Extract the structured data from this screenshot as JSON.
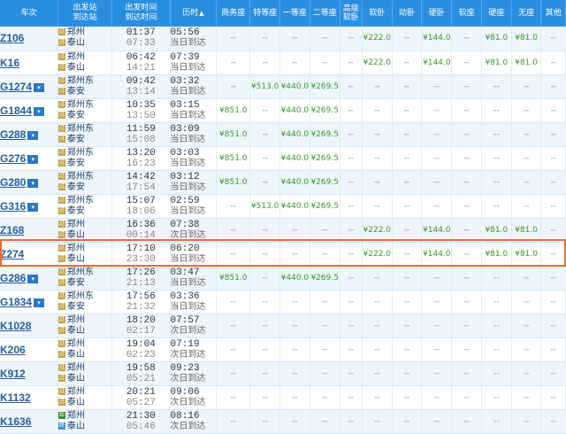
{
  "headers": {
    "train": "车次",
    "stations": [
      "出发站",
      "到达站"
    ],
    "times": [
      "出发时间",
      "到达时间"
    ],
    "duration": "历时",
    "seats": [
      "商务座",
      "特等座",
      "一等座",
      "二等座",
      "高级软卧",
      "软卧",
      "动卧",
      "硬卧",
      "软座",
      "硬座",
      "无座",
      "其他"
    ],
    "sort_arrow": "▲"
  },
  "rows": [
    {
      "train": "Z106",
      "dropdown": false,
      "dep_station": "郑州",
      "arr_station": "泰山",
      "dep_type": "pass",
      "arr_type": "pass",
      "dep_time": "01:37",
      "arr_time": "07:33",
      "duration": "05:56",
      "arrival_note": "当日到达",
      "seats": [
        "--",
        "--",
        "--",
        "--",
        "--",
        "¥222.0",
        "--",
        "¥144.0",
        "--",
        "¥81.0",
        "¥81.0",
        "--"
      ]
    },
    {
      "train": "K16",
      "dropdown": false,
      "dep_station": "郑州",
      "arr_station": "泰山",
      "dep_type": "pass",
      "arr_type": "pass",
      "dep_time": "06:42",
      "arr_time": "14:21",
      "duration": "07:39",
      "arrival_note": "当日到达",
      "seats": [
        "--",
        "--",
        "--",
        "--",
        "--",
        "¥222.0",
        "--",
        "¥144.0",
        "--",
        "¥81.0",
        "¥81.0",
        "--"
      ]
    },
    {
      "train": "G1274",
      "dropdown": true,
      "dep_station": "郑州东",
      "arr_station": "泰安",
      "dep_type": "pass",
      "arr_type": "pass",
      "dep_time": "09:42",
      "arr_time": "13:14",
      "duration": "03:32",
      "arrival_note": "当日到达",
      "seats": [
        "--",
        "¥513.0",
        "¥440.0",
        "¥269.5",
        "--",
        "--",
        "--",
        "--",
        "--",
        "--",
        "--",
        "--"
      ]
    },
    {
      "train": "G1844",
      "dropdown": true,
      "dep_station": "郑州东",
      "arr_station": "泰安",
      "dep_type": "pass",
      "arr_type": "pass",
      "dep_time": "10:35",
      "arr_time": "13:50",
      "duration": "03:15",
      "arrival_note": "当日到达",
      "seats": [
        "¥851.0",
        "--",
        "¥440.0",
        "¥269.5",
        "--",
        "--",
        "--",
        "--",
        "--",
        "--",
        "--",
        "--"
      ]
    },
    {
      "train": "G288",
      "dropdown": true,
      "dep_station": "郑州东",
      "arr_station": "泰安",
      "dep_type": "pass",
      "arr_type": "pass",
      "dep_time": "11:59",
      "arr_time": "15:08",
      "duration": "03:09",
      "arrival_note": "当日到达",
      "seats": [
        "¥851.0",
        "--",
        "¥440.0",
        "¥269.5",
        "--",
        "--",
        "--",
        "--",
        "--",
        "--",
        "--",
        "--"
      ]
    },
    {
      "train": "G276",
      "dropdown": true,
      "dep_station": "郑州东",
      "arr_station": "泰安",
      "dep_type": "pass",
      "arr_type": "pass",
      "dep_time": "13:20",
      "arr_time": "16:23",
      "duration": "03:03",
      "arrival_note": "当日到达",
      "seats": [
        "¥851.0",
        "--",
        "¥440.0",
        "¥269.5",
        "--",
        "--",
        "--",
        "--",
        "--",
        "--",
        "--",
        "--"
      ]
    },
    {
      "train": "G280",
      "dropdown": true,
      "dep_station": "郑州东",
      "arr_station": "泰安",
      "dep_type": "pass",
      "arr_type": "pass",
      "dep_time": "14:42",
      "arr_time": "17:54",
      "duration": "03:12",
      "arrival_note": "当日到达",
      "seats": [
        "¥851.0",
        "--",
        "¥440.0",
        "¥269.5",
        "--",
        "--",
        "--",
        "--",
        "--",
        "--",
        "--",
        "--"
      ]
    },
    {
      "train": "G316",
      "dropdown": true,
      "dep_station": "郑州东",
      "arr_station": "泰安",
      "dep_type": "pass",
      "arr_type": "pass",
      "dep_time": "15:07",
      "arr_time": "18:06",
      "duration": "02:59",
      "arrival_note": "当日到达",
      "seats": [
        "--",
        "¥513.0",
        "¥440.0",
        "¥269.5",
        "--",
        "--",
        "--",
        "--",
        "--",
        "--",
        "--",
        "--"
      ]
    },
    {
      "train": "Z168",
      "dropdown": false,
      "dep_station": "郑州",
      "arr_station": "泰山",
      "dep_type": "pass",
      "arr_type": "pass",
      "dep_time": "16:36",
      "arr_time": "00:14",
      "duration": "07:38",
      "arrival_note": "次日到达",
      "seats": [
        "--",
        "--",
        "--",
        "--",
        "--",
        "¥222.0",
        "--",
        "¥144.0",
        "--",
        "¥81.0",
        "¥81.0",
        "--"
      ]
    },
    {
      "train": "Z274",
      "dropdown": false,
      "dep_station": "郑州",
      "arr_station": "泰山",
      "dep_type": "pass",
      "arr_type": "pass",
      "dep_time": "17:10",
      "arr_time": "23:30",
      "duration": "06:20",
      "arrival_note": "当日到达",
      "seats": [
        "--",
        "--",
        "--",
        "--",
        "--",
        "¥222.0",
        "--",
        "¥144.0",
        "--",
        "¥81.0",
        "¥81.0",
        "--"
      ]
    },
    {
      "train": "G286",
      "dropdown": true,
      "dep_station": "郑州东",
      "arr_station": "泰安",
      "dep_type": "pass",
      "arr_type": "pass",
      "dep_time": "17:26",
      "arr_time": "21:13",
      "duration": "03:47",
      "arrival_note": "当日到达",
      "seats": [
        "¥851.0",
        "--",
        "¥440.0",
        "¥269.5",
        "--",
        "--",
        "--",
        "--",
        "--",
        "--",
        "--",
        "--"
      ]
    },
    {
      "train": "G1834",
      "dropdown": true,
      "dep_station": "郑州东",
      "arr_station": "泰安",
      "dep_type": "pass",
      "arr_type": "pass",
      "dep_time": "17:56",
      "arr_time": "21:32",
      "duration": "03:36",
      "arrival_note": "当日到达",
      "seats": [
        "--",
        "--",
        "--",
        "--",
        "--",
        "--",
        "--",
        "--",
        "--",
        "--",
        "--",
        "--"
      ]
    },
    {
      "train": "K1028",
      "dropdown": false,
      "dep_station": "郑州",
      "arr_station": "泰山",
      "dep_type": "pass",
      "arr_type": "pass",
      "dep_time": "18:20",
      "arr_time": "02:17",
      "duration": "07:57",
      "arrival_note": "次日到达",
      "seats": [
        "--",
        "--",
        "--",
        "--",
        "--",
        "--",
        "--",
        "--",
        "--",
        "--",
        "--",
        "--"
      ]
    },
    {
      "train": "K206",
      "dropdown": false,
      "dep_station": "郑州",
      "arr_station": "泰山",
      "dep_type": "pass",
      "arr_type": "pass",
      "dep_time": "19:04",
      "arr_time": "02:23",
      "duration": "07:19",
      "arrival_note": "次日到达",
      "seats": [
        "--",
        "--",
        "--",
        "--",
        "--",
        "--",
        "--",
        "--",
        "--",
        "--",
        "--",
        "--"
      ]
    },
    {
      "train": "K912",
      "dropdown": false,
      "dep_station": "郑州",
      "arr_station": "泰山",
      "dep_type": "pass",
      "arr_type": "pass",
      "dep_time": "19:58",
      "arr_time": "05:21",
      "duration": "09:23",
      "arrival_note": "次日到达",
      "seats": [
        "--",
        "--",
        "--",
        "--",
        "--",
        "--",
        "--",
        "--",
        "--",
        "--",
        "--",
        "--"
      ]
    },
    {
      "train": "K1132",
      "dropdown": false,
      "dep_station": "郑州",
      "arr_station": "泰山",
      "dep_type": "pass",
      "arr_type": "pass",
      "dep_time": "20:21",
      "arr_time": "05:27",
      "duration": "09:06",
      "arrival_note": "次日到达",
      "seats": [
        "--",
        "--",
        "--",
        "--",
        "--",
        "--",
        "--",
        "--",
        "--",
        "--",
        "--",
        "--"
      ]
    },
    {
      "train": "K1636",
      "dropdown": false,
      "dep_station": "郑州",
      "arr_station": "泰山",
      "dep_type": "dep",
      "arr_type": "arr",
      "dep_time": "21:30",
      "arr_time": "05:46",
      "duration": "08:16",
      "arrival_note": "次日到达",
      "seats": [
        "--",
        "--",
        "--",
        "--",
        "--",
        "--",
        "--",
        "--",
        "--",
        "--",
        "--",
        "--"
      ]
    }
  ],
  "highlighted_row": "Z274",
  "colors": {
    "header_bg": "#2a8ee0",
    "price_green": "#3a9a2a",
    "train_link": "#2a5d9a",
    "selection_outline": "#ef6a3a",
    "row_stripe": "#eef5fb"
  },
  "icons": {
    "dropdown": "▾",
    "departure_badge": "始",
    "arrival_badge": "终",
    "pass_badge": "过"
  }
}
